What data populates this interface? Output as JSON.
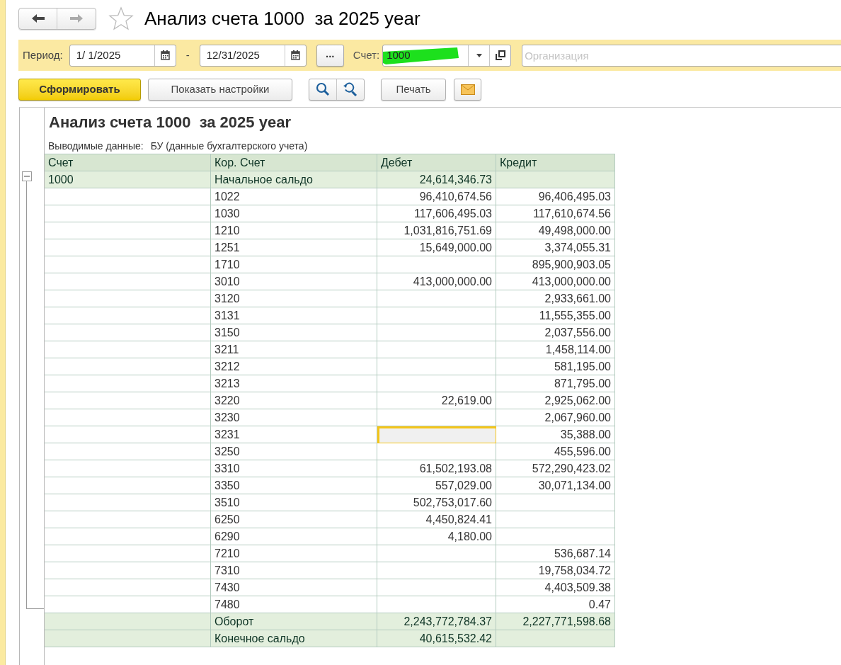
{
  "window": {
    "title": "Анализ счета 1000  за 2025 year",
    "favorite": false
  },
  "filters": {
    "period_label": "Период:",
    "date_from": "1/ 1/2025",
    "separator": "-",
    "date_to": "12/31/2025",
    "more_button": "...",
    "account_label": "Счет:",
    "account": "1000",
    "account_highlighted": true,
    "organization_placeholder": "Организация"
  },
  "toolbar": {
    "generate": "Сформировать",
    "settings": "Показать настройки",
    "print": "Печать"
  },
  "report": {
    "title": "Анализ счета 1000  за 2025 year",
    "output_label": "Выводимые данные:",
    "output_value": "БУ (данные бухгалтерского учета)",
    "columns": [
      "Счет",
      "Кор. Счет",
      "Дебет",
      "Кредит"
    ],
    "group": {
      "expanded": true
    },
    "rows": [
      {
        "kind": "balance",
        "account": "1000",
        "corr_account": "Начальное сальдо",
        "debit": "24,614,346.73",
        "debit_selected": false
      },
      {
        "kind": "entry",
        "corr_account": "1022",
        "debit": "96,410,674.56",
        "credit": "96,406,495.03",
        "debit_selected": false
      },
      {
        "kind": "entry",
        "corr_account": "1030",
        "debit": "117,606,495.03",
        "credit": "117,610,674.56",
        "debit_selected": false
      },
      {
        "kind": "entry",
        "corr_account": "1210",
        "debit": "1,031,816,751.69",
        "credit": "49,498,000.00",
        "debit_selected": false
      },
      {
        "kind": "entry",
        "corr_account": "1251",
        "debit": "15,649,000.00",
        "credit": "3,374,055.31",
        "debit_selected": false
      },
      {
        "kind": "entry",
        "corr_account": "1710",
        "credit": "895,900,903.05",
        "debit_selected": false
      },
      {
        "kind": "entry",
        "corr_account": "3010",
        "debit": "413,000,000.00",
        "credit": "413,000,000.00",
        "debit_selected": false
      },
      {
        "kind": "entry",
        "corr_account": "3120",
        "credit": "2,933,661.00",
        "debit_selected": false
      },
      {
        "kind": "entry",
        "corr_account": "3131",
        "credit": "11,555,355.00",
        "debit_selected": false
      },
      {
        "kind": "entry",
        "corr_account": "3150",
        "credit": "2,037,556.00",
        "debit_selected": false
      },
      {
        "kind": "entry",
        "corr_account": "3211",
        "credit": "1,458,114.00",
        "debit_selected": false
      },
      {
        "kind": "entry",
        "corr_account": "3212",
        "credit": "581,195.00",
        "debit_selected": false
      },
      {
        "kind": "entry",
        "corr_account": "3213",
        "credit": "871,795.00",
        "debit_selected": false
      },
      {
        "kind": "entry",
        "corr_account": "3220",
        "debit": "22,619.00",
        "credit": "2,925,062.00",
        "debit_selected": false
      },
      {
        "kind": "entry",
        "corr_account": "3230",
        "credit": "2,067,960.00",
        "debit_selected": false
      },
      {
        "kind": "entry",
        "corr_account": "3231",
        "credit": "35,388.00",
        "debit_selected": true
      },
      {
        "kind": "entry",
        "corr_account": "3250",
        "credit": "455,596.00",
        "debit_selected": false
      },
      {
        "kind": "entry",
        "corr_account": "3310",
        "debit": "61,502,193.08",
        "credit": "572,290,423.02",
        "debit_selected": false
      },
      {
        "kind": "entry",
        "corr_account": "3350",
        "debit": "557,029.00",
        "credit": "30,071,134.00",
        "debit_selected": false
      },
      {
        "kind": "entry",
        "corr_account": "3510",
        "debit": "502,753,017.60",
        "debit_selected": false
      },
      {
        "kind": "entry",
        "corr_account": "6250",
        "debit": "4,450,824.41",
        "debit_selected": false
      },
      {
        "kind": "entry",
        "corr_account": "6290",
        "debit": "4,180.00",
        "debit_selected": false
      },
      {
        "kind": "entry",
        "corr_account": "7210",
        "credit": "536,687.14",
        "debit_selected": false
      },
      {
        "kind": "entry",
        "corr_account": "7310",
        "credit": "19,758,034.72",
        "debit_selected": false
      },
      {
        "kind": "entry",
        "corr_account": "7430",
        "credit": "4,403,509.38",
        "debit_selected": false
      },
      {
        "kind": "entry",
        "corr_account": "7480",
        "credit": "0.47",
        "debit_selected": false
      },
      {
        "kind": "balance",
        "corr_account": "Оборот",
        "debit": "2,243,772,784.37",
        "credit": "2,227,771,598.68",
        "debit_selected": false
      },
      {
        "kind": "balance",
        "corr_account": "Конечное сальдо",
        "debit": "40,615,532.42",
        "debit_selected": false
      }
    ]
  }
}
